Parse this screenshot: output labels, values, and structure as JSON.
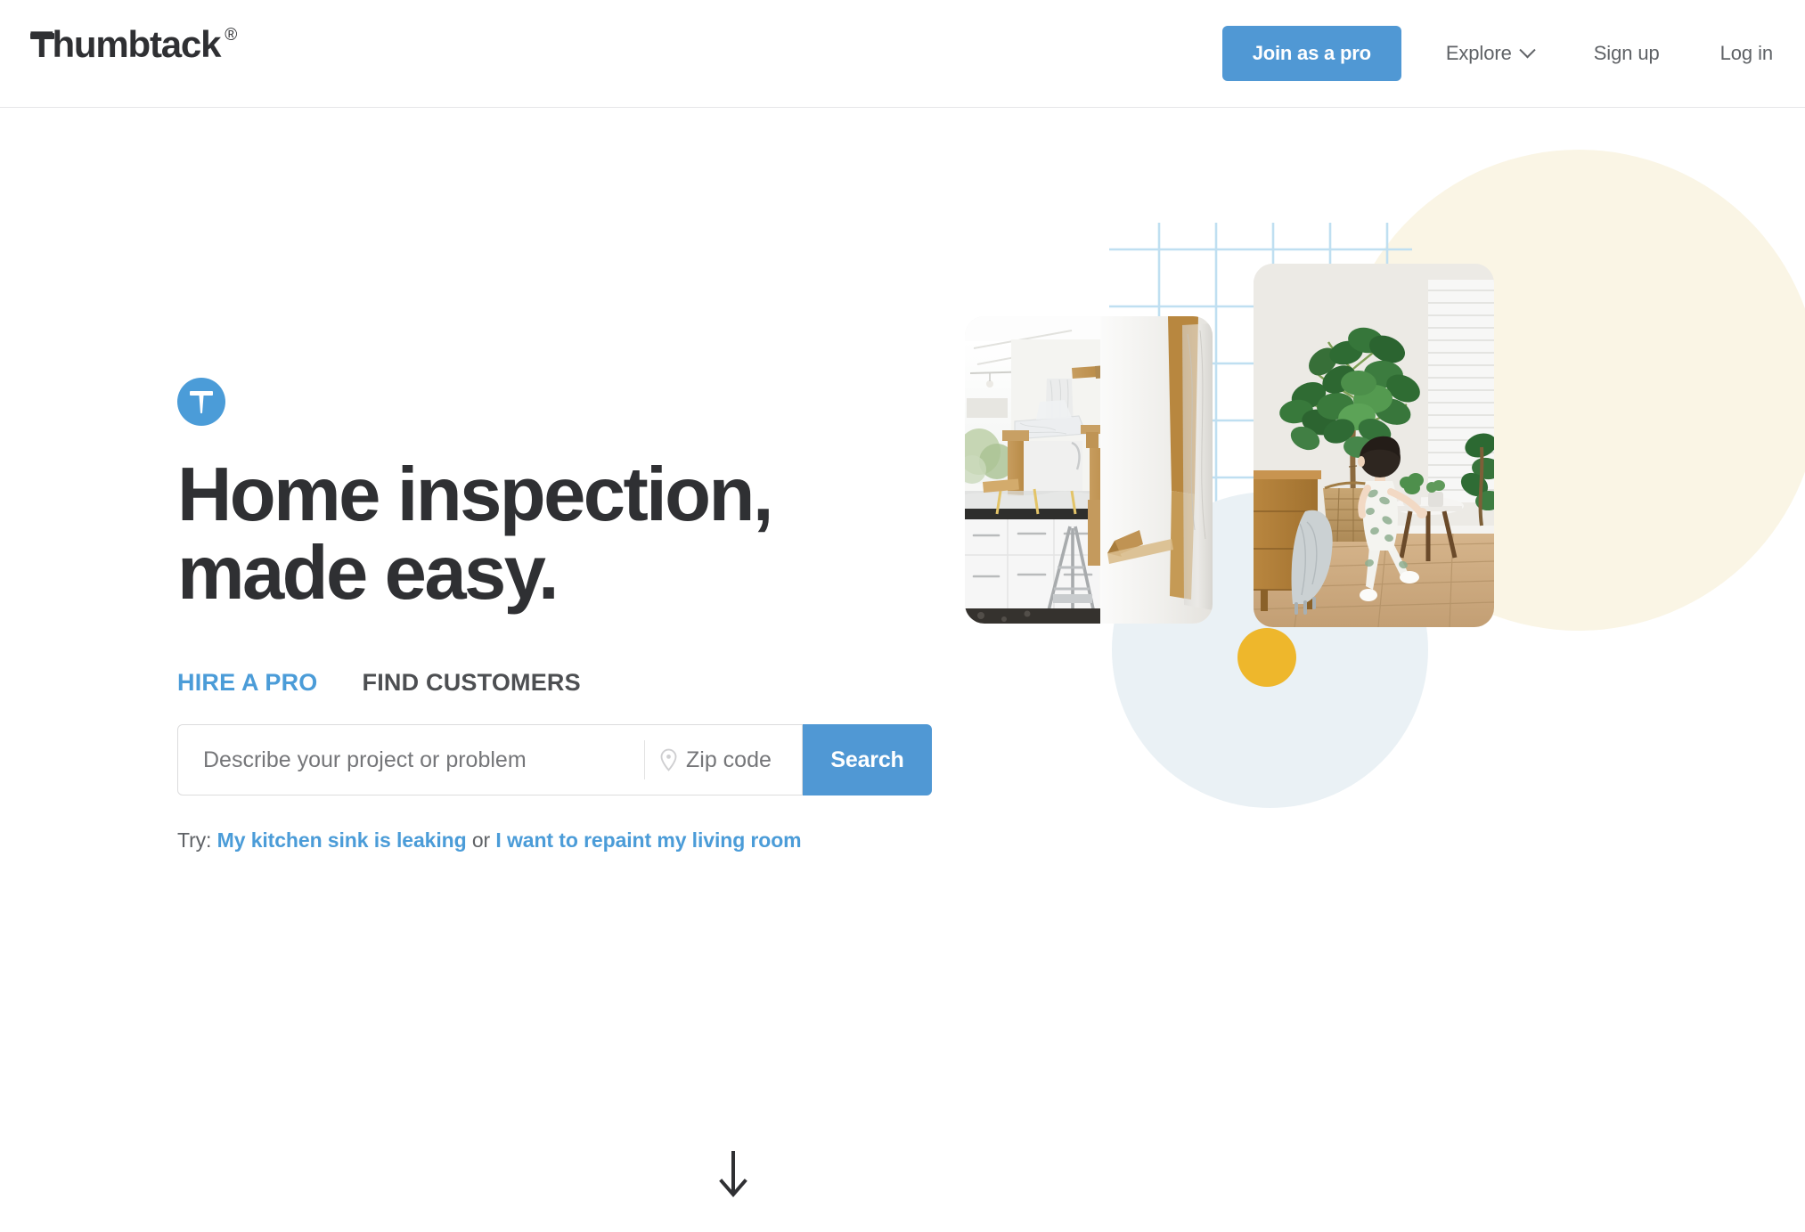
{
  "header": {
    "logo": {
      "text": "Thumbtack",
      "registered_mark": "®",
      "icon": "thumbtack-logo-icon"
    },
    "join_pro_label": "Join as a pro",
    "nav": [
      {
        "label": "Explore",
        "has_chevron": true,
        "icon": "chevron-down-icon"
      },
      {
        "label": "Sign up",
        "has_chevron": false
      },
      {
        "label": "Log in",
        "has_chevron": false
      }
    ]
  },
  "hero": {
    "badge_icon": "thumbtack-pin-icon",
    "headline_line1": "Home inspection,",
    "headline_line2": "made easy.",
    "tabs": [
      {
        "label": "HIRE A PRO",
        "active": true
      },
      {
        "label": "FIND CUSTOMERS",
        "active": false
      }
    ],
    "search": {
      "project_placeholder": "Describe your project or problem",
      "project_value": "",
      "zip_placeholder": "Zip code",
      "zip_value": "",
      "zip_icon": "location-pin-icon",
      "button_label": "Search"
    },
    "try": {
      "prefix": "Try:",
      "suggestion_1": "My kitchen sink is leaking",
      "conjunction": "or",
      "suggestion_2": "I want to repaint my living room"
    }
  },
  "scroll_hint": {
    "icon": "arrow-down-icon"
  },
  "collage": {
    "photo_left_alt": "Kitchen covered in protective plastic sheeting and paper during renovation, with a step ladder",
    "photo_right_alt": "Toddler standing beside a large fiddle-leaf fig tree in a bright living room with wood dresser",
    "decor": {
      "grid": "blue-grid-pattern",
      "cream_circle": "cream-circle-shape",
      "blue_circle": "pale-blue-circle-shape",
      "yellow_dot": "yellow-dot-shape"
    }
  },
  "colors": {
    "brand_blue": "#5098d4",
    "accent_blue": "#4b9cd8",
    "text_dark": "#2f3033",
    "text_muted": "#5f6266",
    "yellow": "#eeb72c",
    "cream": "#faf5e5",
    "pale_blue": "#eaf1f5",
    "grid_blue": "#bfdff1"
  }
}
